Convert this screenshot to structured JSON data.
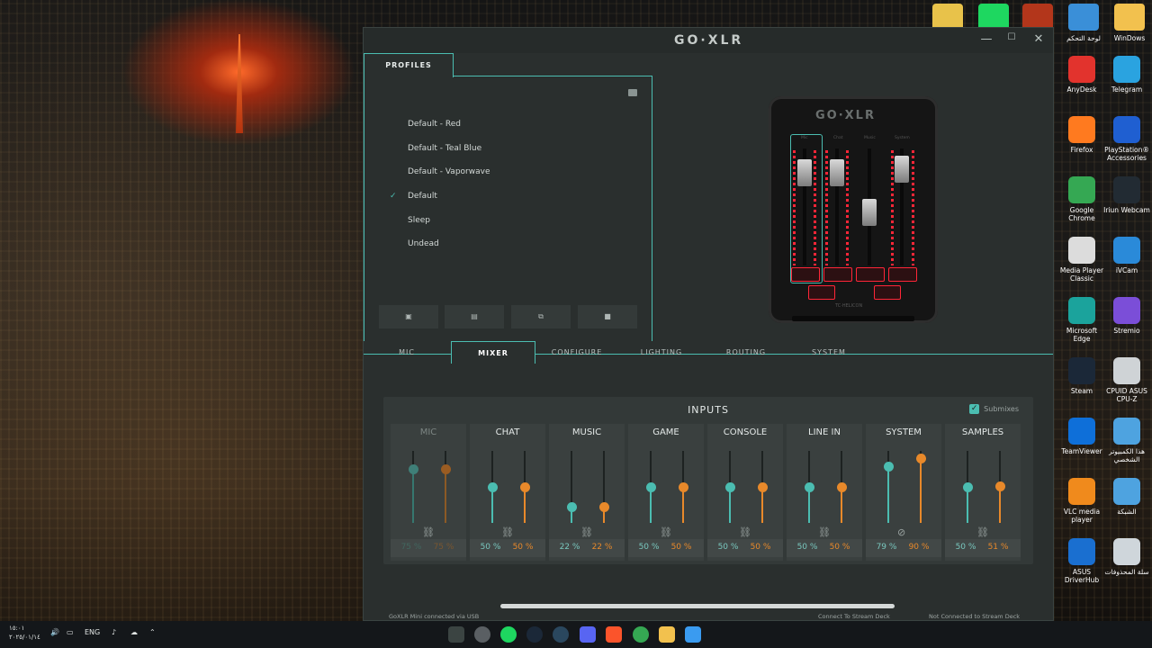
{
  "app": {
    "logo": "GO·XLR",
    "controls": {
      "minimize": "—",
      "maximize": "☐",
      "close": "✕"
    }
  },
  "profiles": {
    "tab_label": "PROFILES",
    "items": [
      {
        "label": "Default - Red",
        "active": false
      },
      {
        "label": "Default - Teal Blue",
        "active": false
      },
      {
        "label": "Default - Vaporwave",
        "active": false
      },
      {
        "label": "Default",
        "active": true
      },
      {
        "label": "Sleep",
        "active": false
      },
      {
        "label": "Undead",
        "active": false
      }
    ],
    "buttons": [
      "save-icon",
      "new-file-icon",
      "copy-icon",
      "delete-icon"
    ]
  },
  "device": {
    "logo": "GO·XLR",
    "model": "MINI",
    "brand": "TC·HELICON",
    "channels": [
      "Mic",
      "Chat",
      "Music",
      "System"
    ]
  },
  "tabs": [
    {
      "label": "MIC",
      "active": false
    },
    {
      "label": "MIXER",
      "active": true
    },
    {
      "label": "CONFIGURE",
      "active": false
    },
    {
      "label": "LIGHTING",
      "active": false
    },
    {
      "label": "ROUTING",
      "active": false
    },
    {
      "label": "SYSTEM",
      "active": false
    }
  ],
  "inputs": {
    "title": "INPUTS",
    "submixes_label": "Submixes",
    "submixes_checked": true,
    "channels": [
      {
        "name": "MIC",
        "a": 75,
        "b": 75,
        "a_label": "75 %",
        "b_label": "75 %",
        "linked": true,
        "dim": true
      },
      {
        "name": "CHAT",
        "a": 50,
        "b": 50,
        "a_label": "50 %",
        "b_label": "50 %",
        "linked": true,
        "dim": false
      },
      {
        "name": "MUSIC",
        "a": 22,
        "b": 22,
        "a_label": "22 %",
        "b_label": "22 %",
        "linked": true,
        "dim": false
      },
      {
        "name": "GAME",
        "a": 50,
        "b": 50,
        "a_label": "50 %",
        "b_label": "50 %",
        "linked": true,
        "dim": false
      },
      {
        "name": "CONSOLE",
        "a": 50,
        "b": 50,
        "a_label": "50 %",
        "b_label": "50 %",
        "linked": true,
        "dim": false
      },
      {
        "name": "LINE IN",
        "a": 50,
        "b": 50,
        "a_label": "50 %",
        "b_label": "50 %",
        "linked": true,
        "dim": false
      },
      {
        "name": "SYSTEM",
        "a": 79,
        "b": 90,
        "a_label": "79 %",
        "b_label": "90 %",
        "linked": false,
        "dim": false
      },
      {
        "name": "SAMPLES",
        "a": 50,
        "b": 51,
        "a_label": "50 %",
        "b_label": "51 %",
        "linked": true,
        "dim": false
      }
    ]
  },
  "statusbar": {
    "left": "GoXLR Mini connected via USB",
    "mid": "Connect To Stream Deck",
    "right": "Not Connected to Stream Deck"
  },
  "desktop": {
    "top_icons": [
      {
        "label": "",
        "color": "#e8c24a"
      },
      {
        "label": "",
        "color": "#1ed760"
      },
      {
        "label": "",
        "color": "#b3361b"
      },
      {
        "label": "لوحة التحكم",
        "color": "#3a8fd8"
      },
      {
        "label": "WinDows",
        "color": "#f2c14e"
      }
    ],
    "icons": [
      {
        "label": "AnyDesk",
        "color": "#e2332d"
      },
      {
        "label": "Telegram",
        "color": "#2aa3e0"
      },
      {
        "label": "Firefox",
        "color": "#ff7a1f"
      },
      {
        "label": "PlayStation® Accessories",
        "color": "#1f5fd1"
      },
      {
        "label": "Google Chrome",
        "color": "#35a853"
      },
      {
        "label": "Iriun Webcam",
        "color": "#222b33"
      },
      {
        "label": "Media Player Classic",
        "color": "#dcdcdc"
      },
      {
        "label": "iVCam",
        "color": "#2a8ad9"
      },
      {
        "label": "Microsoft Edge",
        "color": "#1ba39c"
      },
      {
        "label": "Stremio",
        "color": "#7b4ed8"
      },
      {
        "label": "Steam",
        "color": "#1b2838"
      },
      {
        "label": "CPUID ASUS CPU-Z",
        "color": "#cfd3d6"
      },
      {
        "label": "TeamViewer",
        "color": "#0e6fd9"
      },
      {
        "label": "هذا الكمبيوتر الشخصي",
        "color": "#4ea3e0"
      },
      {
        "label": "VLC media player",
        "color": "#f08a1c"
      },
      {
        "label": "الشبكة",
        "color": "#4ea3e0"
      },
      {
        "label": "ASUS DriverHub",
        "color": "#1a6fd0"
      },
      {
        "label": "سلة المحذوفات",
        "color": "#cfd6db"
      }
    ]
  },
  "taskbar": {
    "time": "١٥:٠١",
    "date": "٢٠٢٥/٠١/١٤",
    "lang": "ENG"
  }
}
